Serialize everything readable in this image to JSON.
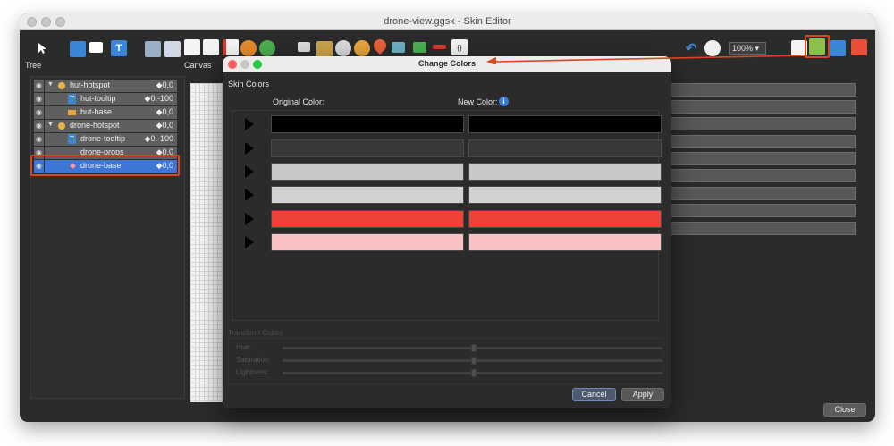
{
  "window": {
    "title": "drone-view.ggsk - Skin Editor"
  },
  "toolbar": {
    "zoom": "100%"
  },
  "panels": {
    "tree_label": "Tree",
    "canvas_label": "Canvas"
  },
  "tree": {
    "rows": [
      {
        "label": "hut-hotspot",
        "value": "◆0,0"
      },
      {
        "label": "hut-tooltip",
        "value": "◆0,-100"
      },
      {
        "label": "hut-base",
        "value": "◆0,0"
      },
      {
        "label": "drone-hotspot",
        "value": "◆0,0"
      },
      {
        "label": "drone-tooltip",
        "value": "◆0,-100"
      },
      {
        "label": "drone-props",
        "value": "◆0,0"
      },
      {
        "label": "drone-base",
        "value": "◆0,0"
      }
    ]
  },
  "footer": {
    "close_label": "Close"
  },
  "dialog": {
    "title": "Change Colors",
    "section_skin_colors": "Skin Colors",
    "original_color_label": "Original Color:",
    "new_color_label": "New Color:",
    "info_glyph": "i",
    "colors": [
      {
        "original": "#000000",
        "new": "#000000"
      },
      {
        "original": "#383838",
        "new": "#383838"
      },
      {
        "original": "#c8c8c8",
        "new": "#c8c8c8"
      },
      {
        "original": "#d2d2d2",
        "new": "#d2d2d2"
      },
      {
        "original": "#f04136",
        "new": "#f04136"
      },
      {
        "original": "#f9c1c1",
        "new": "#f9c1c1"
      }
    ],
    "section_transform": "Transform Colors",
    "hue_label": "Hue:",
    "saturation_label": "Saturation:",
    "lightness_label": "Lightness:",
    "cancel_label": "Cancel",
    "apply_label": "Apply"
  },
  "colors": {
    "annotation": "#d9461f",
    "selection": "#3d76d6",
    "info": "#3a7bd5"
  }
}
